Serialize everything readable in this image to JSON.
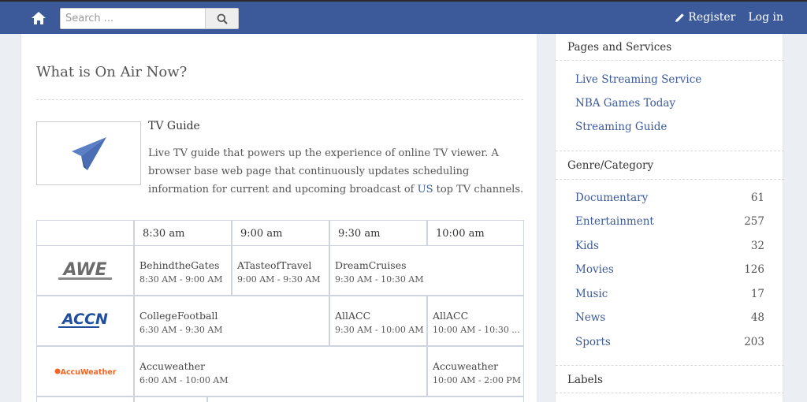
{
  "header": {
    "search_placeholder": "Search ...",
    "register_label": "Register",
    "login_label": "Log in"
  },
  "main": {
    "title": "What is On Air Now?",
    "guide_title": "TV Guide",
    "guide_desc_1": "Live TV guide that powers up the experience of online TV viewer. A browser base web page that continuously updates scheduling information for current and upcoming broadcast of ",
    "guide_desc_hl": "US",
    "guide_desc_2": " top TV channels."
  },
  "schedule": {
    "times": [
      "8:30 am",
      "9:00 am",
      "9:30 am",
      "10:00 am"
    ],
    "channels": [
      {
        "logo_text": "AWE",
        "logo_icon": "awe-logo",
        "programs": [
          {
            "title": "BehindtheGates",
            "time": "8:30 AM - 9:00 AM"
          },
          {
            "title": "ATasteofTravel",
            "time": "9:00 AM - 9:30 AM"
          },
          {
            "title": "DreamCruises",
            "time": "9:30 AM - 10:30 AM"
          }
        ]
      },
      {
        "logo_text": "ACCN",
        "logo_icon": "accn-logo",
        "programs": [
          {
            "title": "CollegeFootball",
            "time": "6:30 AM - 9:30 AM"
          },
          {
            "title": "AllACC",
            "time": "9:30 AM - 10:00 AM"
          },
          {
            "title": "AllACC",
            "time": "10:00 AM - 10:30 ..."
          }
        ]
      },
      {
        "logo_text": "AccuWeather",
        "logo_icon": "accuweather-logo",
        "programs": [
          {
            "title": "Accuweather",
            "time": "6:00 AM - 10:00 AM"
          },
          {
            "title": "Accuweather",
            "time": "10:00 AM - 2:00 PM"
          }
        ]
      }
    ]
  },
  "sidebar": {
    "pages_heading": "Pages and Services",
    "pages": [
      "Live Streaming Service",
      "NBA Games Today",
      "Streaming Guide"
    ],
    "genre_heading": "Genre/Category",
    "genres": [
      {
        "name": "Documentary",
        "count": "61"
      },
      {
        "name": "Entertainment",
        "count": "257"
      },
      {
        "name": "Kids",
        "count": "32"
      },
      {
        "name": "Movies",
        "count": "126"
      },
      {
        "name": "Music",
        "count": "17"
      },
      {
        "name": "News",
        "count": "48"
      },
      {
        "name": "Sports",
        "count": "203"
      }
    ],
    "labels_heading": "Labels"
  },
  "colors": {
    "nav_bg": "#3c5a99",
    "link": "#3c5a99",
    "accn_blue": "#1f4e9c",
    "accuweather_orange": "#f26522",
    "guide_icon": "#5b7fc4"
  }
}
